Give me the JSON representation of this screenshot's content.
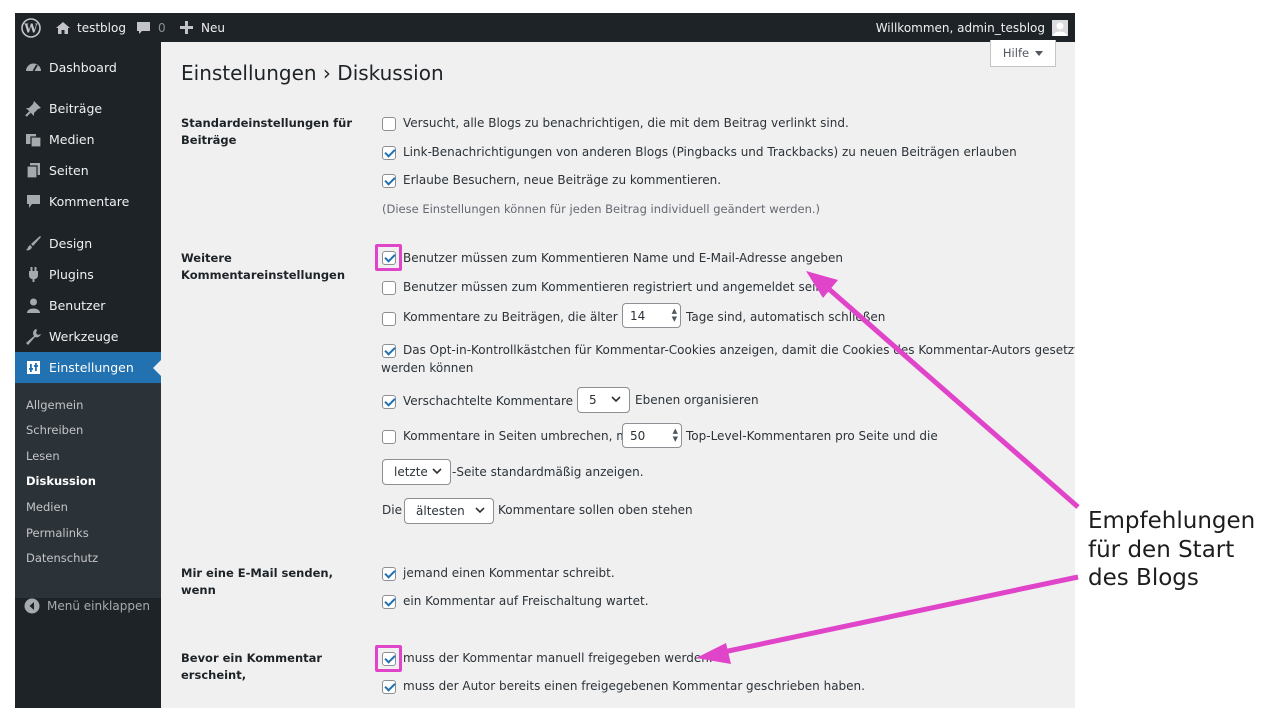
{
  "adminbar": {
    "site_name": "testblog",
    "comments_count": "0",
    "new_label": "Neu",
    "welcome": "Willkommen, admin_tesblog"
  },
  "sidebar": {
    "items": [
      {
        "label": "Dashboard",
        "icon": "dashboard-icon"
      },
      {
        "label": "Beiträge",
        "icon": "pin-icon"
      },
      {
        "label": "Medien",
        "icon": "media-icon"
      },
      {
        "label": "Seiten",
        "icon": "pages-icon"
      },
      {
        "label": "Kommentare",
        "icon": "comment-icon"
      },
      {
        "label": "Design",
        "icon": "brush-icon"
      },
      {
        "label": "Plugins",
        "icon": "plugin-icon"
      },
      {
        "label": "Benutzer",
        "icon": "user-icon"
      },
      {
        "label": "Werkzeuge",
        "icon": "wrench-icon"
      },
      {
        "label": "Einstellungen",
        "icon": "settings-icon"
      }
    ],
    "submenu": [
      "Allgemein",
      "Schreiben",
      "Lesen",
      "Diskussion",
      "Medien",
      "Permalinks",
      "Datenschutz"
    ],
    "collapse_label": "Menü einklappen"
  },
  "help_label": "Hilfe",
  "page_title": "Einstellungen › Diskussion",
  "sections": {
    "default_posts": {
      "heading": "Standardeinstellungen für Beiträge",
      "options": [
        {
          "label": "Versucht, alle Blogs zu benachrichtigen, die mit dem Beitrag verlinkt sind.",
          "checked": false
        },
        {
          "label": "Link-Benachrichtigungen von anderen Blogs (Pingbacks und Trackbacks) zu neuen Beiträgen erlauben",
          "checked": true
        },
        {
          "label": "Erlaube Besuchern, neue Beiträge zu kommentieren.",
          "checked": true
        }
      ],
      "note": "(Diese Einstellungen können für jeden Beitrag individuell geändert werden.)"
    },
    "other_comments": {
      "heading": "Weitere Kommentareinstellungen",
      "name_email": {
        "label": "Benutzer müssen zum Kommentieren Name und E-Mail-Adresse angeben",
        "checked": true
      },
      "registered": {
        "label": "Benutzer müssen zum Kommentieren registriert und angemeldet sein",
        "checked": false
      },
      "close_old": {
        "label_before": "Kommentare zu Beiträgen, die älter als",
        "days": "14",
        "label_after": "Tage sind, automatisch schließen",
        "checked": false
      },
      "cookies": {
        "label_line1": "Das Opt-in-Kontrollkästchen für Kommentar-Cookies anzeigen, damit die Cookies des Kommentar-Autors gesetzt",
        "label_line2": "werden können",
        "checked": true
      },
      "threaded": {
        "label_before": "Verschachtelte Kommentare in",
        "levels": "5",
        "label_after": "Ebenen organisieren",
        "checked": true
      },
      "paged": {
        "label_before": "Kommentare in Seiten umbrechen, mit",
        "per_page": "50",
        "label_after": "Top-Level-Kommentaren pro Seite und die",
        "checked": false
      },
      "default_page": {
        "value": "letzte",
        "label_after": "-Seite standardmäßig anzeigen."
      },
      "order": {
        "label_before": "Die",
        "value": "ältesten",
        "label_after": "Kommentare sollen oben stehen"
      }
    },
    "email_me": {
      "heading": "Mir eine E-Mail senden, wenn",
      "options": [
        {
          "label": "jemand einen Kommentar schreibt.",
          "checked": true
        },
        {
          "label": "ein Kommentar auf Freischaltung wartet.",
          "checked": true
        }
      ]
    },
    "before_appears": {
      "heading": "Bevor ein Kommentar erscheint,",
      "options": [
        {
          "label": "muss der Kommentar manuell freigegeben werden.",
          "checked": true
        },
        {
          "label": "muss der Autor bereits einen freigegebenen Kommentar geschrieben haben.",
          "checked": true
        }
      ]
    }
  },
  "annotation": {
    "line1": "Empfehlungen",
    "line2": "für den Start",
    "line3": "des Blogs",
    "color": "#e045c9"
  },
  "colors": {
    "accent": "#2271b1",
    "adminbar": "#1d2327",
    "highlight": "#e045c9"
  }
}
